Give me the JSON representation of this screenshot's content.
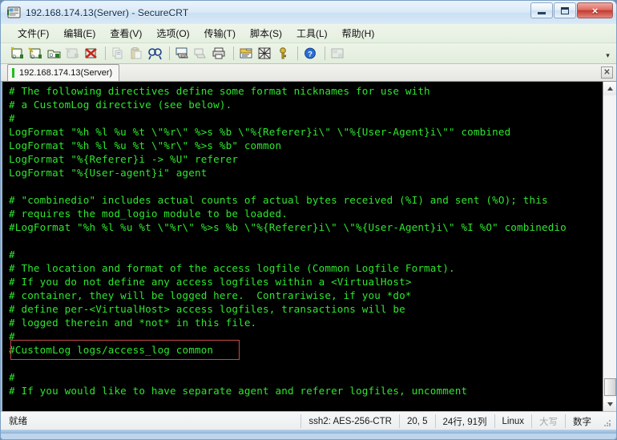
{
  "window": {
    "title": "192.168.174.13(Server) - SecureCRT",
    "icon": "securecrt-app-icon",
    "minimize_label": "最小化",
    "maximize_label": "最大化",
    "close_label": "×"
  },
  "menubar": {
    "items": [
      {
        "label": "文件(F)",
        "name": "menu-file"
      },
      {
        "label": "编辑(E)",
        "name": "menu-edit"
      },
      {
        "label": "查看(V)",
        "name": "menu-view"
      },
      {
        "label": "选项(O)",
        "name": "menu-options"
      },
      {
        "label": "传输(T)",
        "name": "menu-transfer"
      },
      {
        "label": "脚本(S)",
        "name": "menu-script"
      },
      {
        "label": "工具(L)",
        "name": "menu-tools"
      },
      {
        "label": "帮助(H)",
        "name": "menu-help"
      }
    ]
  },
  "toolbar": {
    "icons": [
      "new-session-icon",
      "clone-session-icon",
      "connect-folder-icon",
      "reconnect-icon",
      "disconnect-icon",
      "copy-icon",
      "paste-icon",
      "find-icon",
      "print-screen-icon",
      "log-session-icon",
      "print-icon",
      "session-options-icon",
      "settings-icon",
      "key-icon",
      "help-icon",
      "arrange-windows-icon"
    ],
    "overflow_label": "▾"
  },
  "tabbar": {
    "tabs": [
      {
        "label": "192.168.174.13(Server)",
        "active": true,
        "led_color": "#22bb22"
      }
    ],
    "close_label": "✕"
  },
  "terminal": {
    "fg_color": "#2ee62e",
    "bg_color": "#000000",
    "highlight_color": "#c94a4a",
    "lines": [
      "# The following directives define some format nicknames for use with",
      "# a CustomLog directive (see below).",
      "#",
      "LogFormat \"%h %l %u %t \\\"%r\\\" %>s %b \\\"%{Referer}i\\\" \\\"%{User-Agent}i\\\"\" combined",
      "LogFormat \"%h %l %u %t \\\"%r\\\" %>s %b\" common",
      "LogFormat \"%{Referer}i -> %U\" referer",
      "LogFormat \"%{User-agent}i\" agent",
      "",
      "# \"combinedio\" includes actual counts of actual bytes received (%I) and sent (%O); this",
      "# requires the mod_logio module to be loaded.",
      "#LogFormat \"%h %l %u %t \\\"%r\\\" %>s %b \\\"%{Referer}i\\\" \\\"%{User-Agent}i\\\" %I %O\" combinedio",
      "",
      "#",
      "# The location and format of the access logfile (Common Logfile Format).",
      "# If you do not define any access logfiles within a <VirtualHost>",
      "# container, they will be logged here.  Contrariwise, if you *do*",
      "# define per-<VirtualHost> access logfiles, transactions will be",
      "# logged therein and *not* in this file.",
      "#",
      "#CustomLog logs/access_log common",
      "",
      "#",
      "# If you would like to have separate agent and referer logfiles, uncomment",
      ""
    ]
  },
  "scrollbar": {
    "up_label": "▲",
    "down_label": "▼"
  },
  "statusbar": {
    "ready": "就绪",
    "cipher": "ssh2: AES-256-CTR",
    "cursor": "20,  5",
    "size": "24行, 91列",
    "emulation": "Linux",
    "caps": "大写",
    "num": "数字"
  }
}
